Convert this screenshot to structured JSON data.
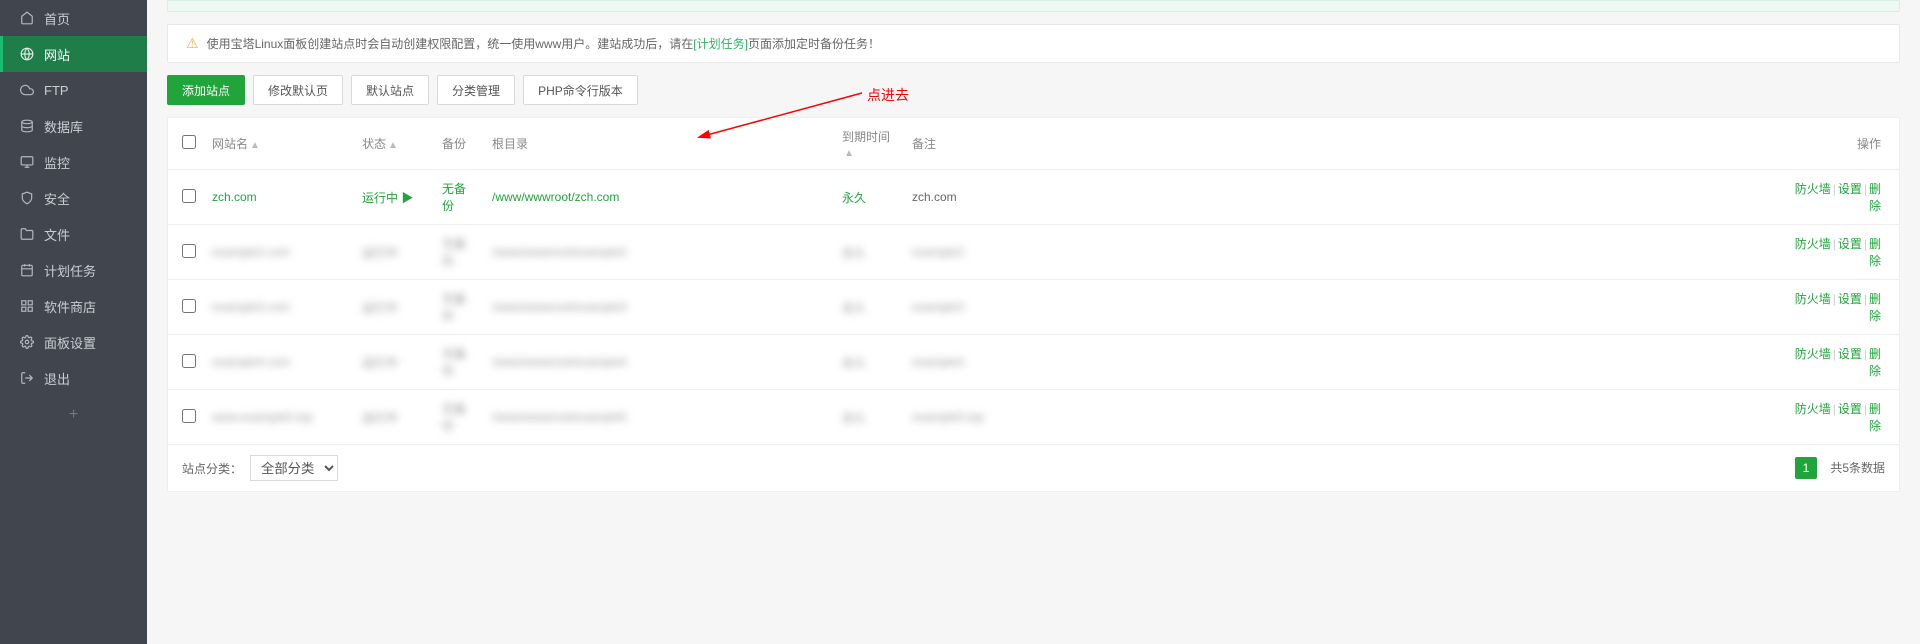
{
  "sidebar": {
    "items": [
      {
        "label": "首页",
        "icon": "home"
      },
      {
        "label": "网站",
        "icon": "globe",
        "active": true
      },
      {
        "label": "FTP",
        "icon": "cloud"
      },
      {
        "label": "数据库",
        "icon": "database"
      },
      {
        "label": "监控",
        "icon": "monitor"
      },
      {
        "label": "安全",
        "icon": "shield"
      },
      {
        "label": "文件",
        "icon": "folder"
      },
      {
        "label": "计划任务",
        "icon": "calendar"
      },
      {
        "label": "软件商店",
        "icon": "app"
      },
      {
        "label": "面板设置",
        "icon": "gear"
      },
      {
        "label": "退出",
        "icon": "exit"
      }
    ]
  },
  "info_bar": {
    "text_before": "使用宝塔Linux面板创建站点时会自动创建权限配置，统一使用www用户。建站成功后，请在",
    "link_text": "[计划任务]",
    "text_after": "页面添加定时备份任务！"
  },
  "toolbar": {
    "add_site": "添加站点",
    "edit_default": "修改默认页",
    "default_site": "默认站点",
    "category_manage": "分类管理",
    "php_cli": "PHP命令行版本"
  },
  "annotation": {
    "text": "点进去"
  },
  "table": {
    "headers": {
      "site_name": "网站名",
      "status": "状态",
      "backup": "备份",
      "root": "根目录",
      "expire": "到期时间",
      "remark": "备注",
      "ops": "操作"
    },
    "rows": [
      {
        "name": "zch.com",
        "status": "运行中 ▶",
        "backup": "无备份",
        "root": "/www/wwwroot/zch.com",
        "expire": "永久",
        "remark": "zch.com",
        "blur": false
      },
      {
        "name": "example2.com",
        "status": "运行中",
        "backup": "无备份",
        "root": "/www/wwwroot/example2",
        "expire": "永久",
        "remark": "example2",
        "blur": true
      },
      {
        "name": "example3.com",
        "status": "运行中",
        "backup": "无备份",
        "root": "/www/wwwroot/example3",
        "expire": "永久",
        "remark": "example3",
        "blur": true
      },
      {
        "name": "example4.com",
        "status": "运行中",
        "backup": "无备份",
        "root": "/www/wwwroot/example4",
        "expire": "永久",
        "remark": "example4",
        "blur": true
      },
      {
        "name": "www.example5.top",
        "status": "运行中",
        "backup": "无备份",
        "root": "/www/wwwroot/example5",
        "expire": "永久",
        "remark": "example5.top",
        "blur": true
      }
    ],
    "ops": {
      "firewall": "防火墙",
      "settings": "设置",
      "delete": "删除"
    }
  },
  "footer": {
    "category_label": "站点分类：",
    "category_value": "全部分类",
    "page_current": "1",
    "total_text": "共5条数据"
  }
}
